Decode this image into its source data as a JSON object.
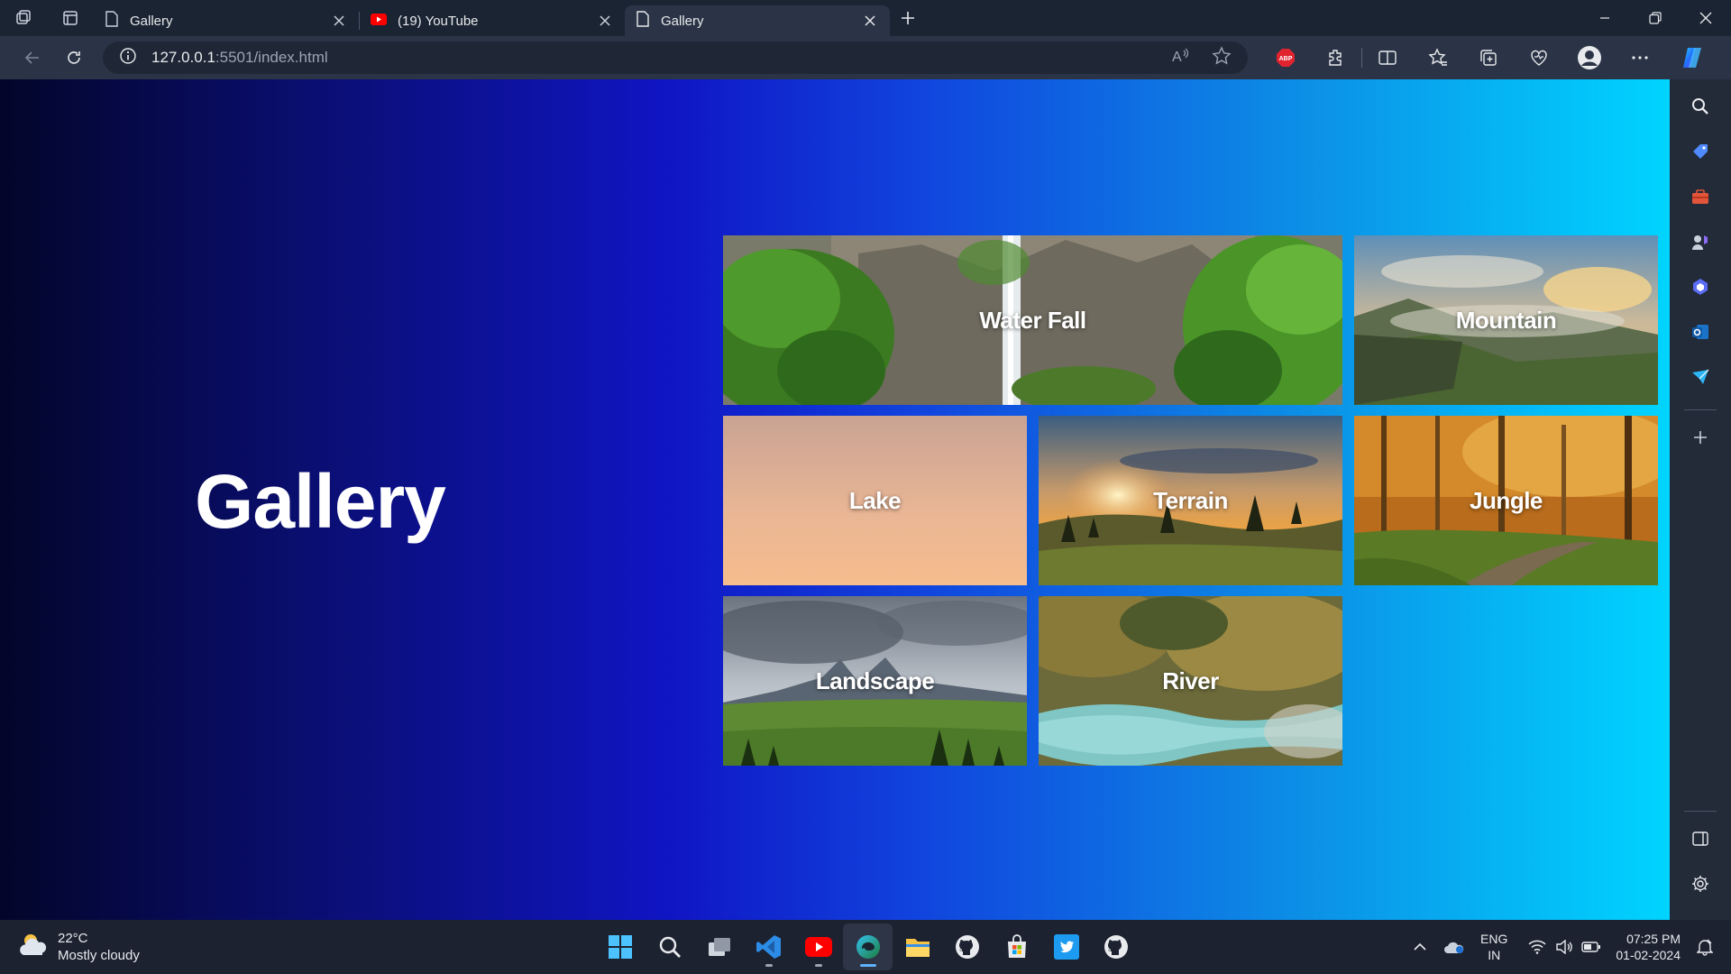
{
  "browser": {
    "tabs": [
      {
        "title": "Gallery",
        "icon": "page-icon",
        "active": false
      },
      {
        "title": "(19) YouTube",
        "icon": "youtube-icon",
        "active": false
      },
      {
        "title": "Gallery",
        "icon": "page-icon",
        "active": true
      }
    ],
    "address": {
      "host": "127.0.0.1",
      "rest": ":5501/index.html"
    }
  },
  "page": {
    "title": "Gallery",
    "cards": [
      {
        "label": "Water Fall",
        "wide": true
      },
      {
        "label": "Mountain",
        "wide": false
      },
      {
        "label": "Lake",
        "wide": false
      },
      {
        "label": "Terrain",
        "wide": false
      },
      {
        "label": "Jungle",
        "wide": false
      },
      {
        "label": "Landscape",
        "wide": false
      },
      {
        "label": "River",
        "wide": false
      }
    ]
  },
  "taskbar": {
    "weather": {
      "temp": "22°C",
      "condition": "Mostly cloudy"
    },
    "language": {
      "line1": "ENG",
      "line2": "IN"
    },
    "clock": {
      "time": "07:25 PM",
      "date": "01-02-2024"
    }
  },
  "colors": {
    "accent": "#5fb3ff",
    "youtube": "#ff0000",
    "vscode": "#2c8ce6"
  }
}
